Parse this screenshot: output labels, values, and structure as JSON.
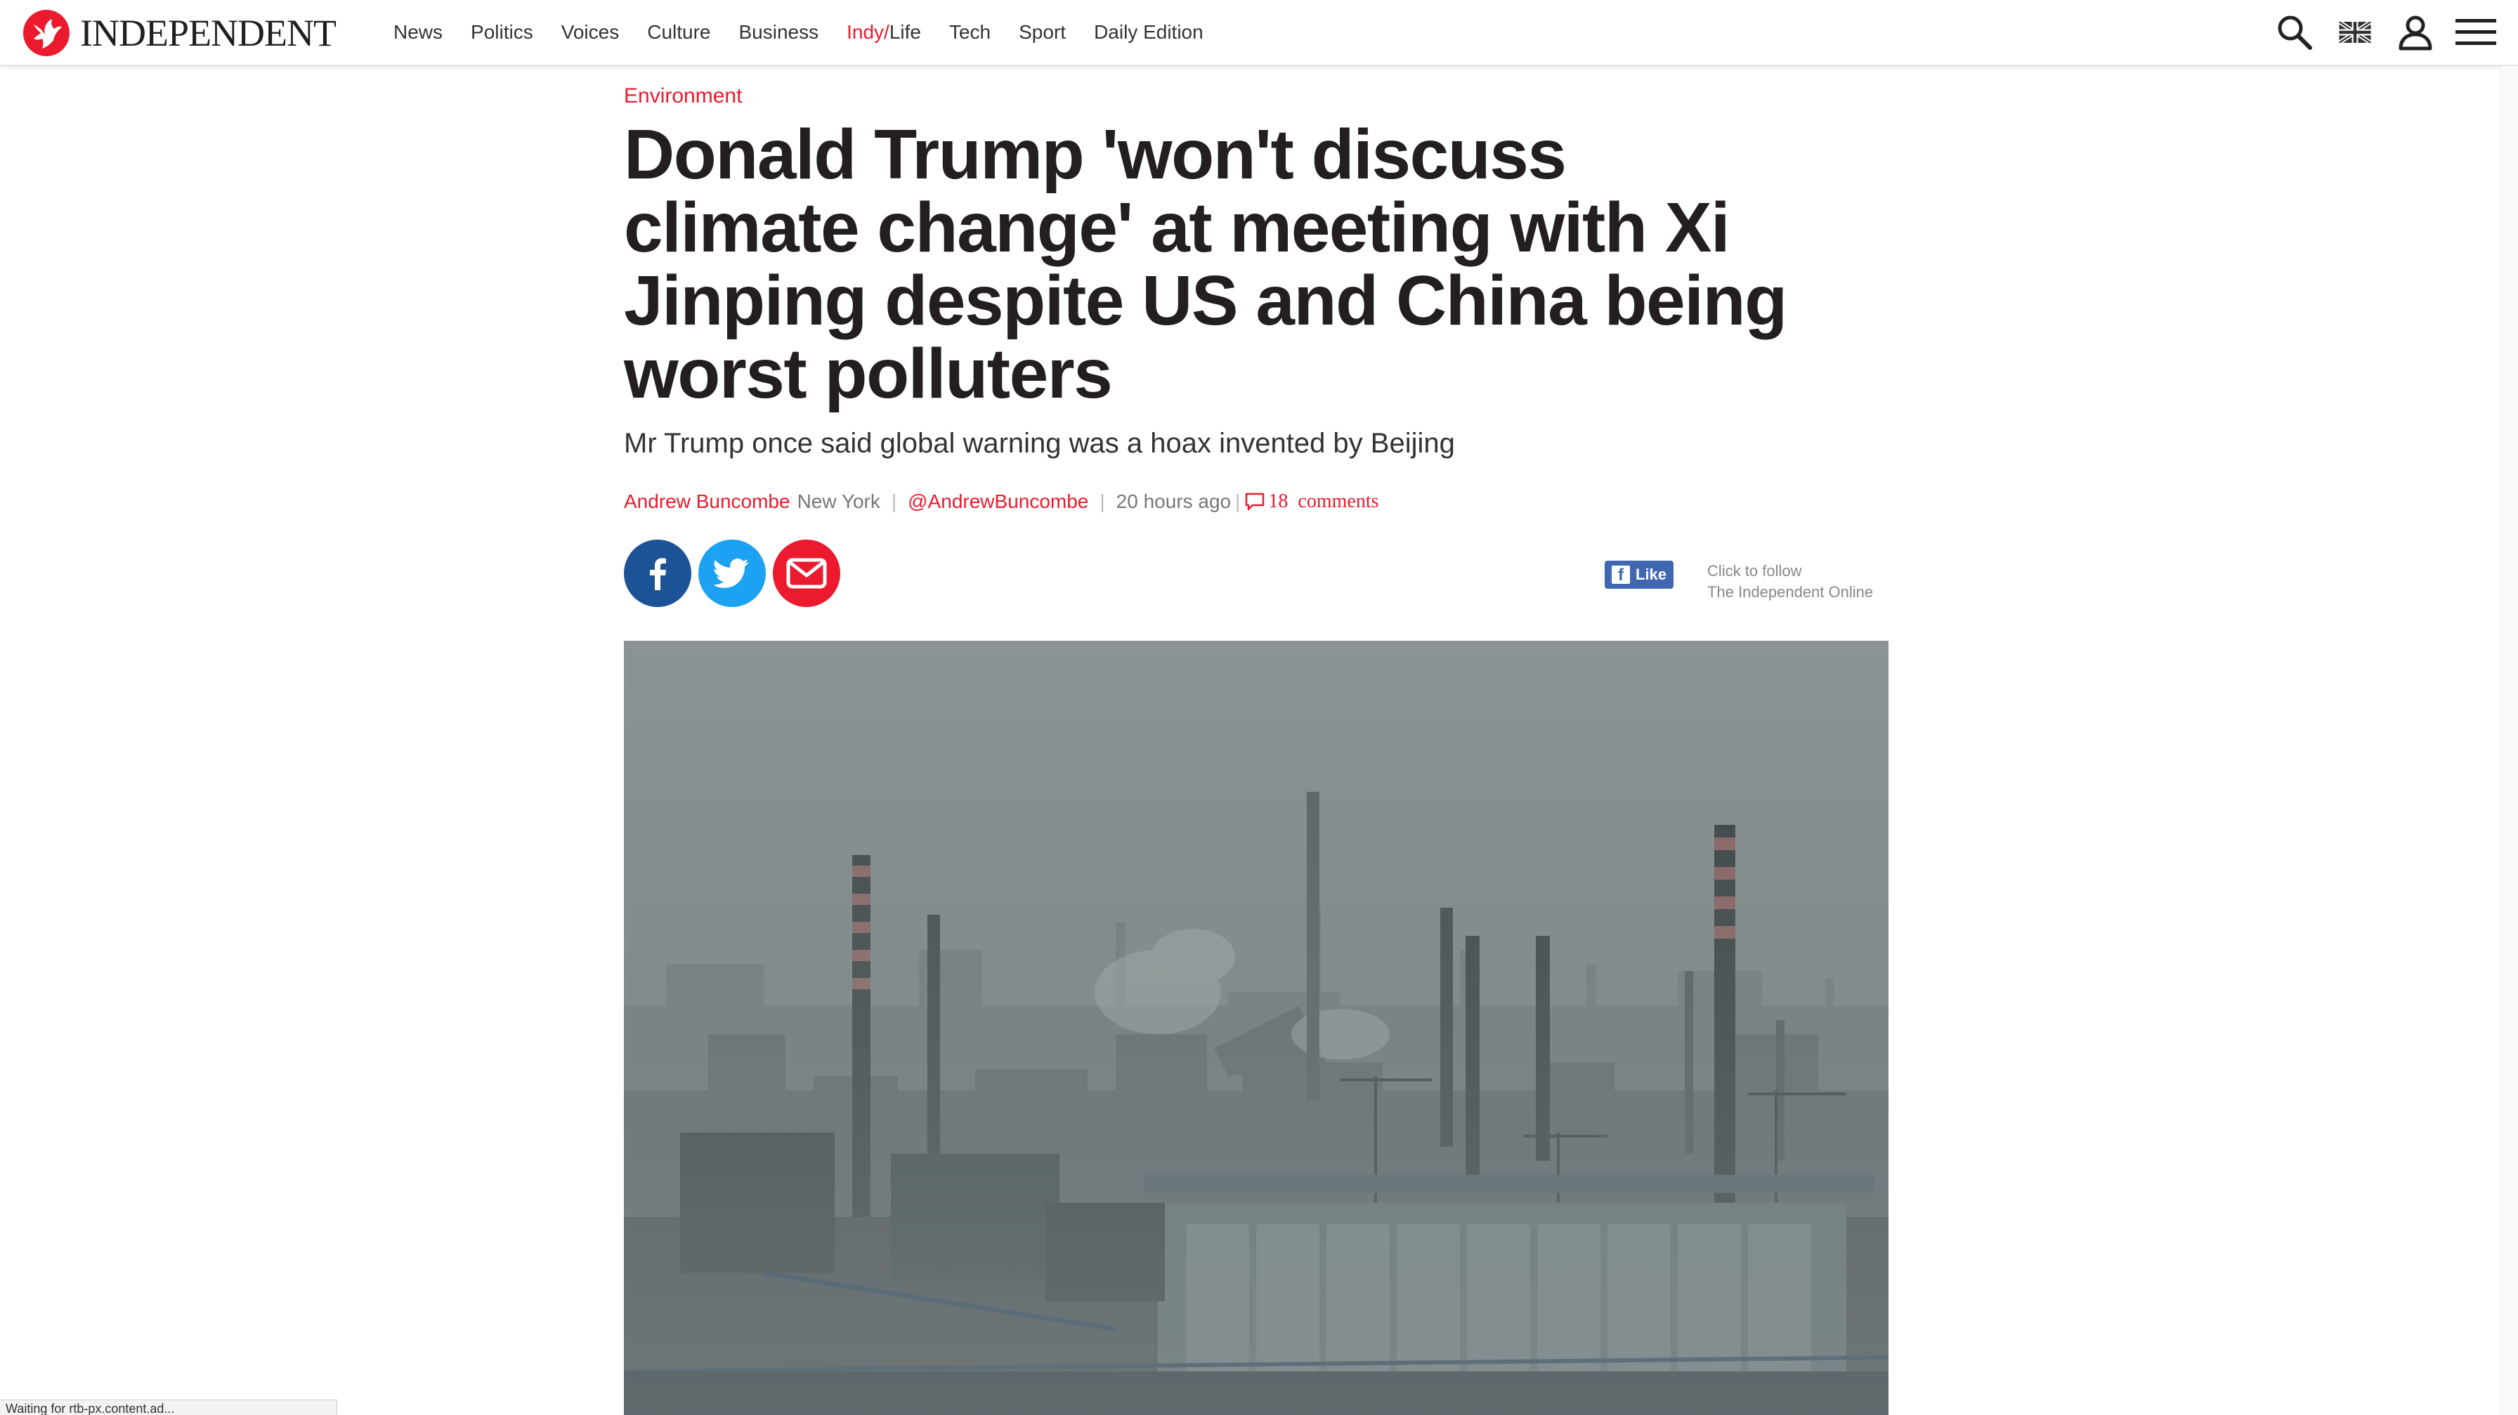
{
  "brand": {
    "name": "INDEPENDENT",
    "accent_color": "#ec1a2e"
  },
  "nav": {
    "items": [
      {
        "label": "News"
      },
      {
        "label": "Politics"
      },
      {
        "label": "Voices"
      },
      {
        "label": "Culture"
      },
      {
        "label": "Business"
      },
      {
        "label_prefix": "Indy/",
        "label_suffix": "Life"
      },
      {
        "label": "Tech"
      },
      {
        "label": "Sport"
      },
      {
        "label": "Daily Edition"
      }
    ]
  },
  "tools": [
    "search-icon",
    "uk-flag-icon",
    "user-icon",
    "menu-icon"
  ],
  "article": {
    "section": "Environment",
    "headline": "Donald Trump 'won't discuss climate change' at meeting with Xi Jinping despite US and China being worst polluters",
    "standfirst": "Mr Trump once said global warning was a hoax invented by Beijing",
    "byline": {
      "author": "Andrew Buncombe",
      "location": "New York",
      "twitter": "@AndrewBuncombe",
      "time": "20 hours ago",
      "comments_count": "18",
      "comments_label": "comments"
    },
    "share": [
      "facebook-share",
      "twitter-share",
      "email-share"
    ],
    "facebook": {
      "like_label": "Like",
      "follow_line1": "Click to follow",
      "follow_line2": "The Independent Online"
    }
  },
  "status_bar": {
    "text": "Waiting for rtb-px.content.ad..."
  }
}
